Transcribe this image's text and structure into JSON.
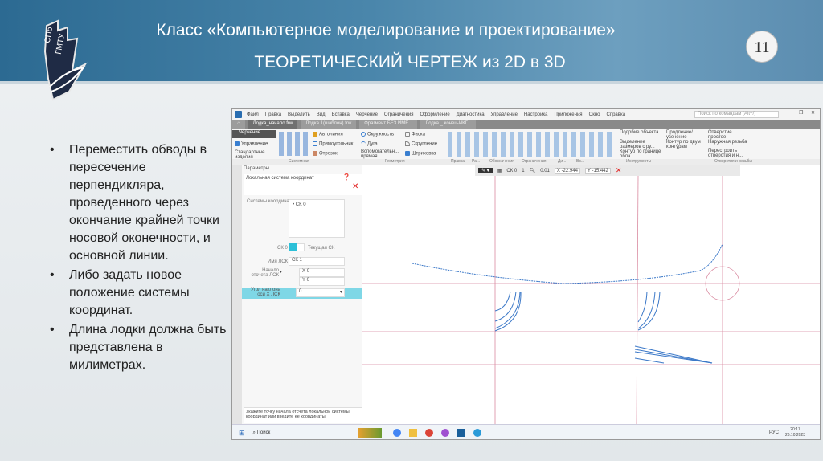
{
  "header": {
    "title": "Класс «Компьютерное моделирование и проектирование»",
    "subtitle": "ТЕОРЕТИЧЕСКИЙ ЧЕРТЕЖ из 2D в 3D",
    "page_number": "11",
    "logo_text": "СПб ГМТУ"
  },
  "bullets": [
    "Переместить обводы в пересечение перпендикляра, проведенного через окончание крайней точки носовой оконечности, и основной линии.",
    "Либо задать новое положение системы координат.",
    "Длина лодки должна быть представлена в милиметрах."
  ],
  "app": {
    "menu": [
      "Файл",
      "Правка",
      "Выделить",
      "Вид",
      "Вставка",
      "Черчение",
      "Ограничения",
      "Оформление",
      "Диагностика",
      "Управление",
      "Настройка",
      "Приложения",
      "Окно",
      "Справка"
    ],
    "search_placeholder": "Поиск по командам (Alt+/)",
    "tabs": [
      "Лодка_начало.frw",
      "Лодка 1(шаблон).frw",
      "Фрагмент БЕЗ ИМЕ...",
      "Лодка _ конец-ИКГ..."
    ],
    "ribbon": {
      "left": [
        "Черчение",
        "Управление",
        "Стандартные изделия"
      ],
      "geometry": [
        "Автолиния",
        "Прямоугольник",
        "Отрезок",
        "Окружность",
        "Дуга",
        "Вспомогательн... прямая",
        "Фаска",
        "Скругление",
        "Штриховка"
      ],
      "tools": [
        "Подобие объекта",
        "Выделение размеров с ру...",
        "Контур по границе обла...",
        "Продление/ усечение",
        "Контур по двум контурам"
      ],
      "holes": [
        "Отверстие простое",
        "Наружная резьба",
        "Перестроить отверстия и н..."
      ],
      "group_labels": [
        "Системная",
        "Геометрия",
        "Правка",
        "Ра...",
        "Обозначения",
        "Ограничения",
        "Ди...",
        "Вс...",
        "Инструменты",
        "Отверстия и резьбы"
      ]
    },
    "params": {
      "title": "Параметры",
      "subtitle": "Локальная система координат",
      "cs_label": "Системы координат",
      "cs_item": "СК 0",
      "ck_label": "СК 0",
      "current_label": "Текущая СК",
      "name_label": "Имя ЛСК",
      "name_value": "СК 1",
      "origin_label": "Начало отсчета ЛСК",
      "x_label": "X",
      "x_value": "0",
      "y_label": "Y",
      "y_value": "0",
      "angle_label": "Угол наклона оси X ЛСК",
      "angle_value": "0",
      "hint": "Укажите точку начала отсчета локальной системы координат или введите ее координаты"
    },
    "toolbar": {
      "cs": "СК 0",
      "layer": "1",
      "scale": "0.01",
      "x": "-22.944",
      "y": "-15.442"
    },
    "taskbar": {
      "search": "Поиск",
      "lang": "РУС",
      "time": "20:17",
      "date": "26.10.2023"
    }
  },
  "colors": {
    "header": "#2c6a92",
    "curve": "#3b78c8",
    "construction": "#d98aa0"
  }
}
